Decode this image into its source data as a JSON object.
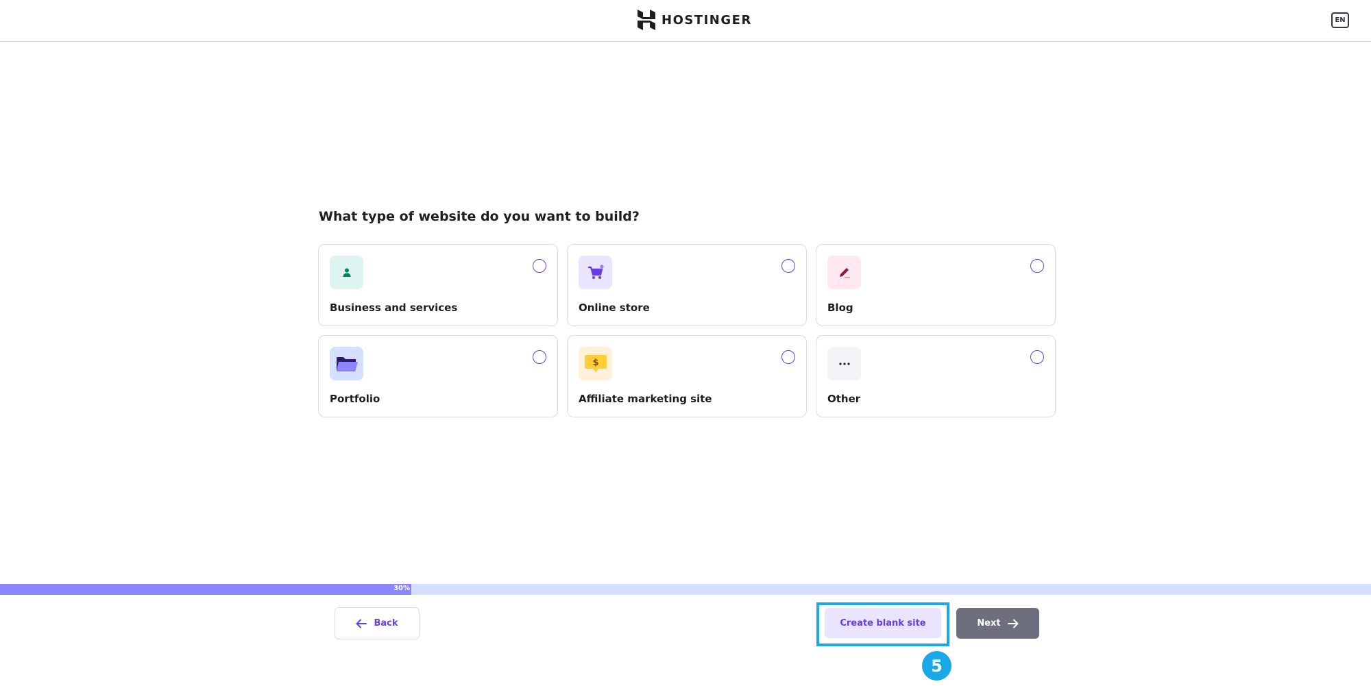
{
  "header": {
    "brand": "HOSTINGER",
    "language": "EN"
  },
  "main": {
    "question": "What type of website do you want to build?",
    "options": [
      {
        "label": "Business and services",
        "icon": "person-icon",
        "icon_bg": "#def4f0",
        "icon_color": "#00b090",
        "selected": false
      },
      {
        "label": "Online store",
        "icon": "cart-icon",
        "icon_bg": "#ebe4ff",
        "icon_color": "#673de6",
        "selected": false
      },
      {
        "label": "Blog",
        "icon": "pen-icon",
        "icon_bg": "#ffe8ef",
        "icon_color": "#d63163",
        "selected": false
      },
      {
        "label": "Portfolio",
        "icon": "folder-icon",
        "icon_bg": "#d5dfff",
        "icon_color": "#8c85ff",
        "selected": false
      },
      {
        "label": "Affiliate marketing site",
        "icon": "dollar-chat-icon",
        "icon_bg": "#fff0d9",
        "icon_color": "#ffcd35",
        "selected": false
      },
      {
        "label": "Other",
        "icon": "more-dots-icon",
        "icon_bg": "#f2f3f6",
        "icon_color": "#1d1e20",
        "selected": false
      }
    ]
  },
  "progress": {
    "value": 0.3,
    "label": "30%"
  },
  "footer": {
    "back_label": "Back",
    "blank_label": "Create blank site",
    "next_label": "Next"
  },
  "annotation": {
    "step_number": "5"
  },
  "colors": {
    "accent": "#673de6",
    "progress_fill": "#8c85ff",
    "progress_track": "#d5dfff",
    "highlight": "#19a9e6",
    "next_button": "#6d6f7e"
  }
}
